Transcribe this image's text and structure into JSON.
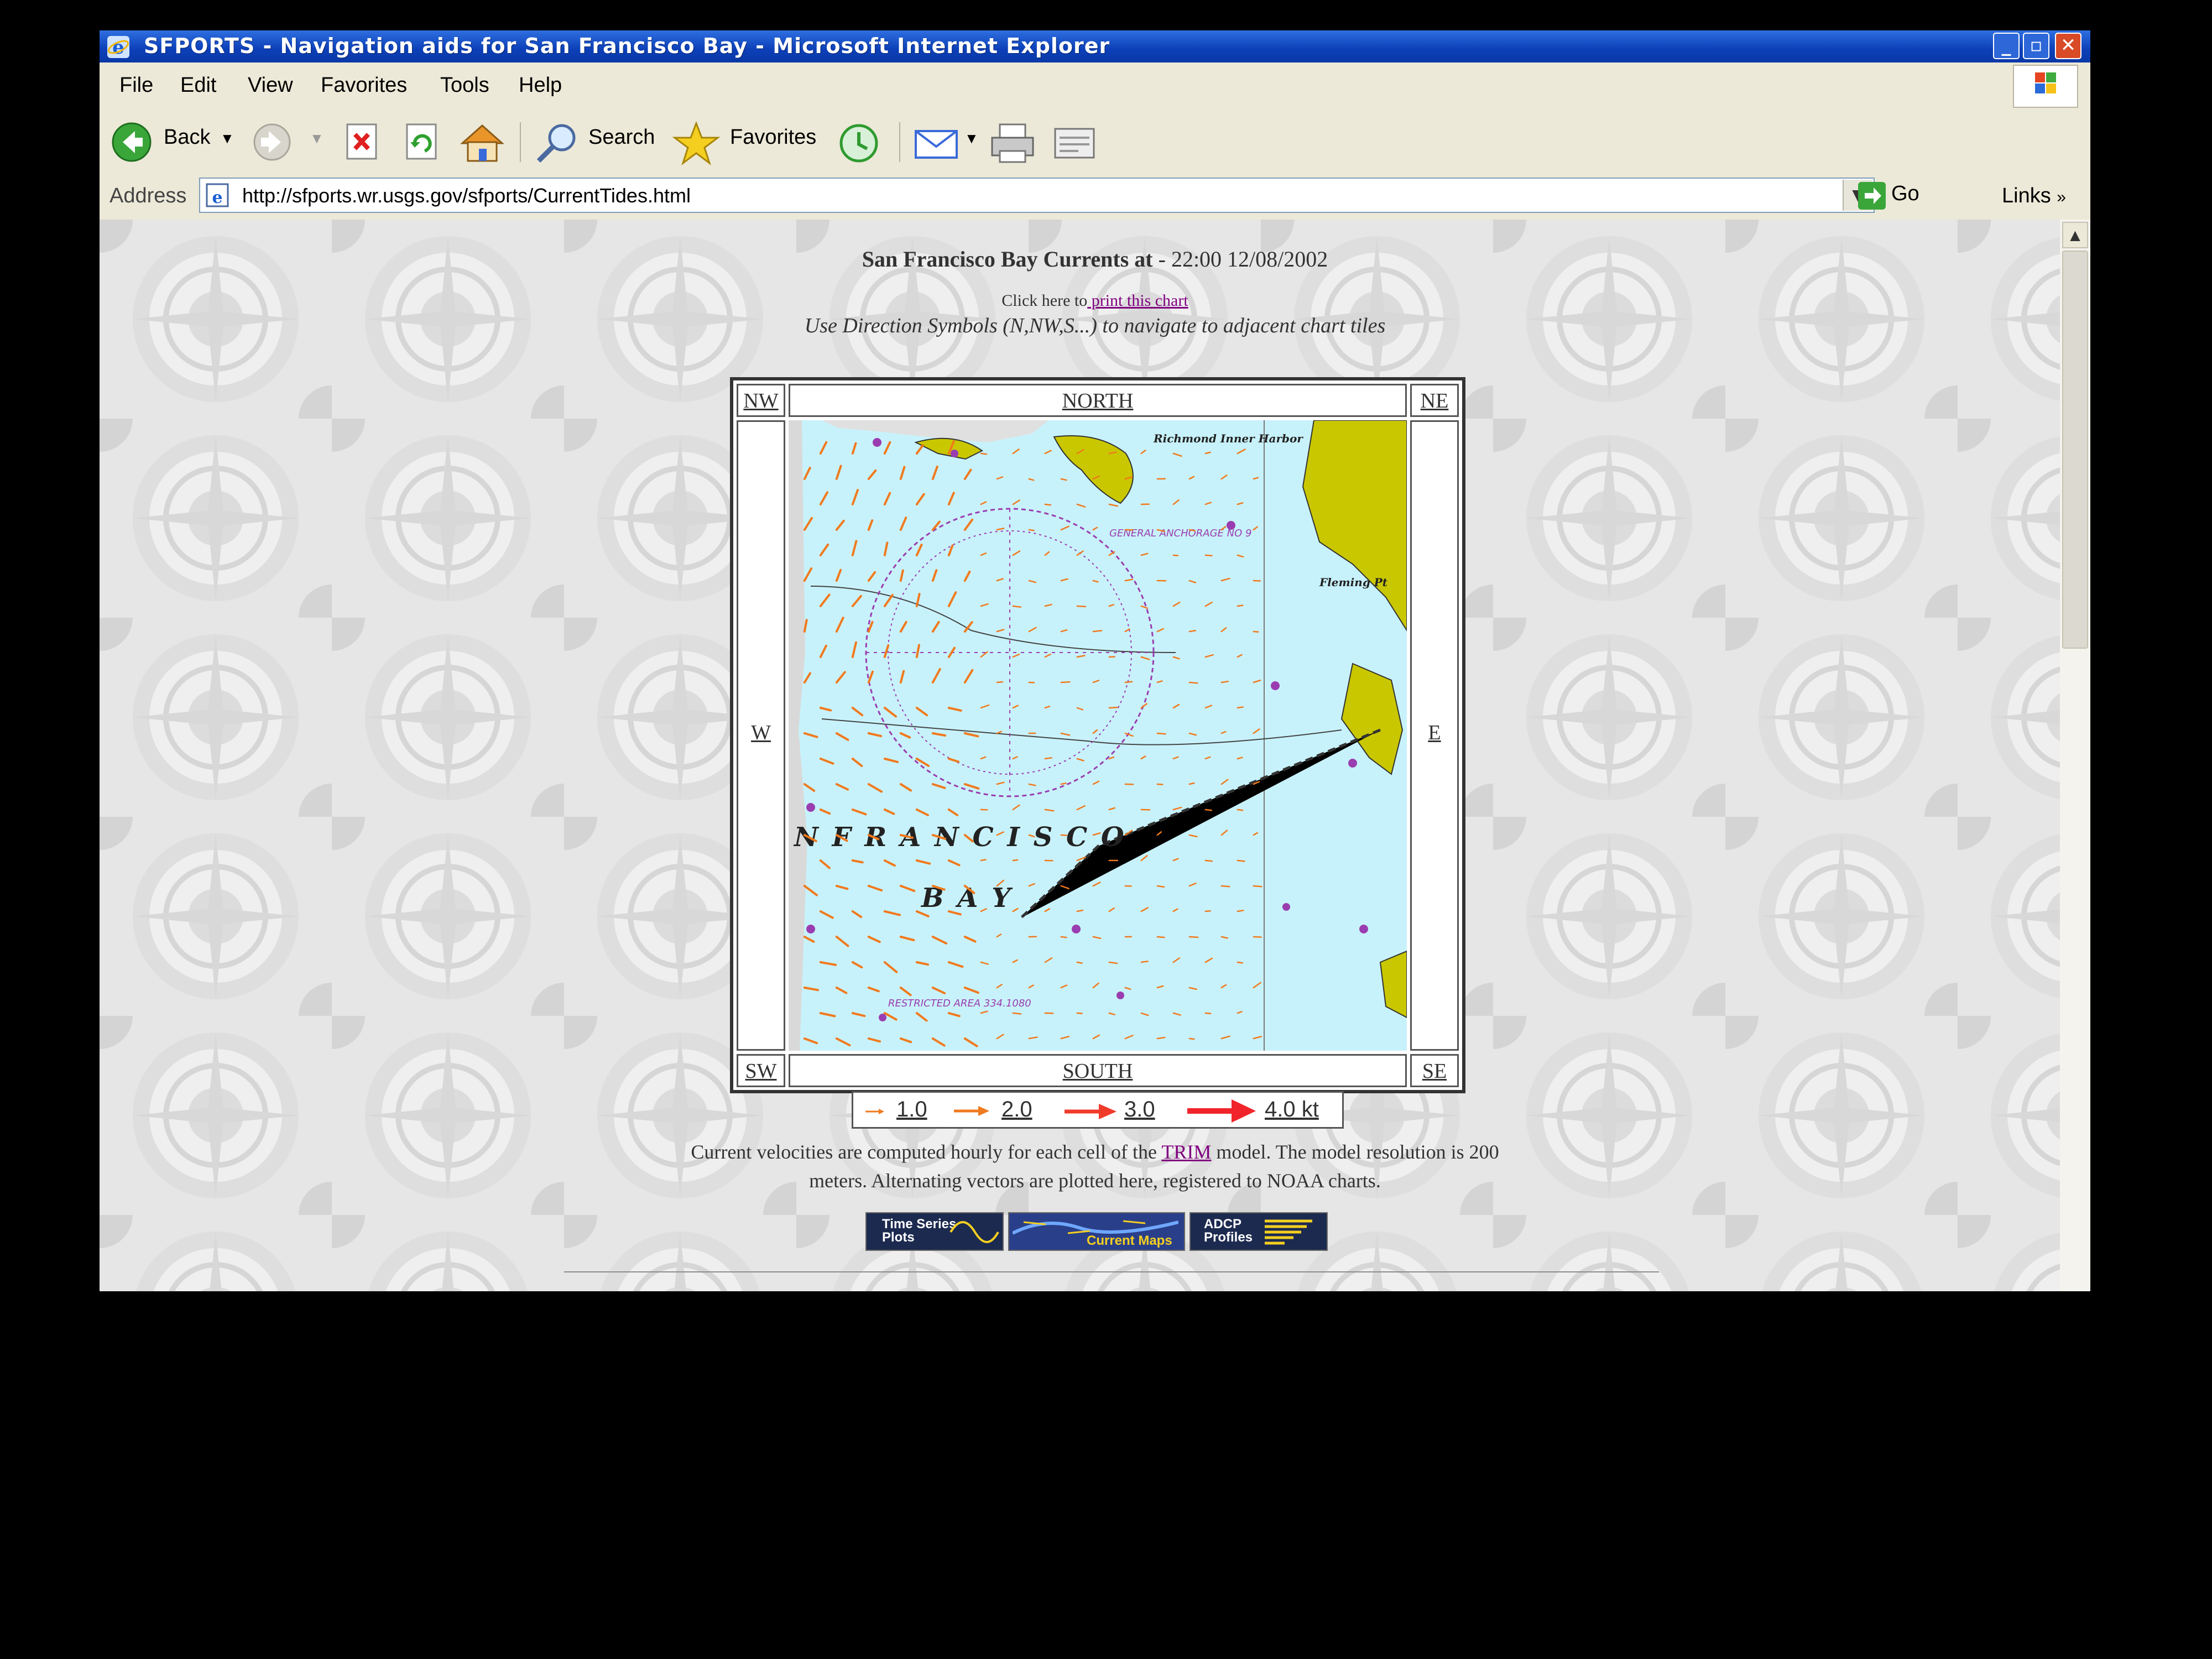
{
  "window": {
    "title": "SFPORTS - Navigation aids for San Francisco Bay - Microsoft Internet Explorer"
  },
  "menu": [
    "File",
    "Edit",
    "View",
    "Favorites",
    "Tools",
    "Help"
  ],
  "toolbar": {
    "back": "Back",
    "search": "Search",
    "favorites": "Favorites"
  },
  "address": {
    "label": "Address",
    "url": "http://sfports.wr.usgs.gov/sfports/CurrentTides.html",
    "go": "Go",
    "links": "Links"
  },
  "page": {
    "heading_bold": "San Francisco Bay Currents at",
    "heading_time": " -  22:00  12/08/2002",
    "print_prefix": "Click here to",
    "print_link": " print this chart",
    "instructions": "Use Direction Symbols (N,NW,S...) to navigate to adjacent chart tiles",
    "directions": {
      "nw": "NW",
      "north": "NORTH",
      "ne": "NE",
      "w": "W",
      "e": "E",
      "sw": "SW",
      "south": "SOUTH",
      "se": "SE"
    },
    "map_labels": {
      "francisco": "N   F  R  A  N  C  I  S  C  O",
      "bay": "B  A  Y",
      "richmond": "Richmond Inner Harbor",
      "fleming": "Fleming Pt",
      "anchorage": "GENERAL ANCHORAGE NO 9",
      "restricted": "RESTRICTED AREA 334.1080"
    },
    "legend": [
      "1.0",
      "2.0",
      "3.0",
      "4.0 kt"
    ],
    "desc_prefix": "Current velocities are computed hourly for each cell of the ",
    "desc_link": "TRIM",
    "desc_suffix": " model. The model resolution is 200",
    "desc_line2": "meters. Alternating vectors are plotted here, registered to NOAA charts.",
    "nav_buttons": {
      "time_series_1": "Time Series",
      "time_series_2": "Plots",
      "current_maps": "Current Maps",
      "adcp_1": "ADCP",
      "adcp_2": "Profiles"
    }
  },
  "colors": {
    "water": "#c8f2fb",
    "land": "#c9c700",
    "arrow": "#f07a1e",
    "chart_purple": "#9a3db0",
    "link": "#800080"
  }
}
